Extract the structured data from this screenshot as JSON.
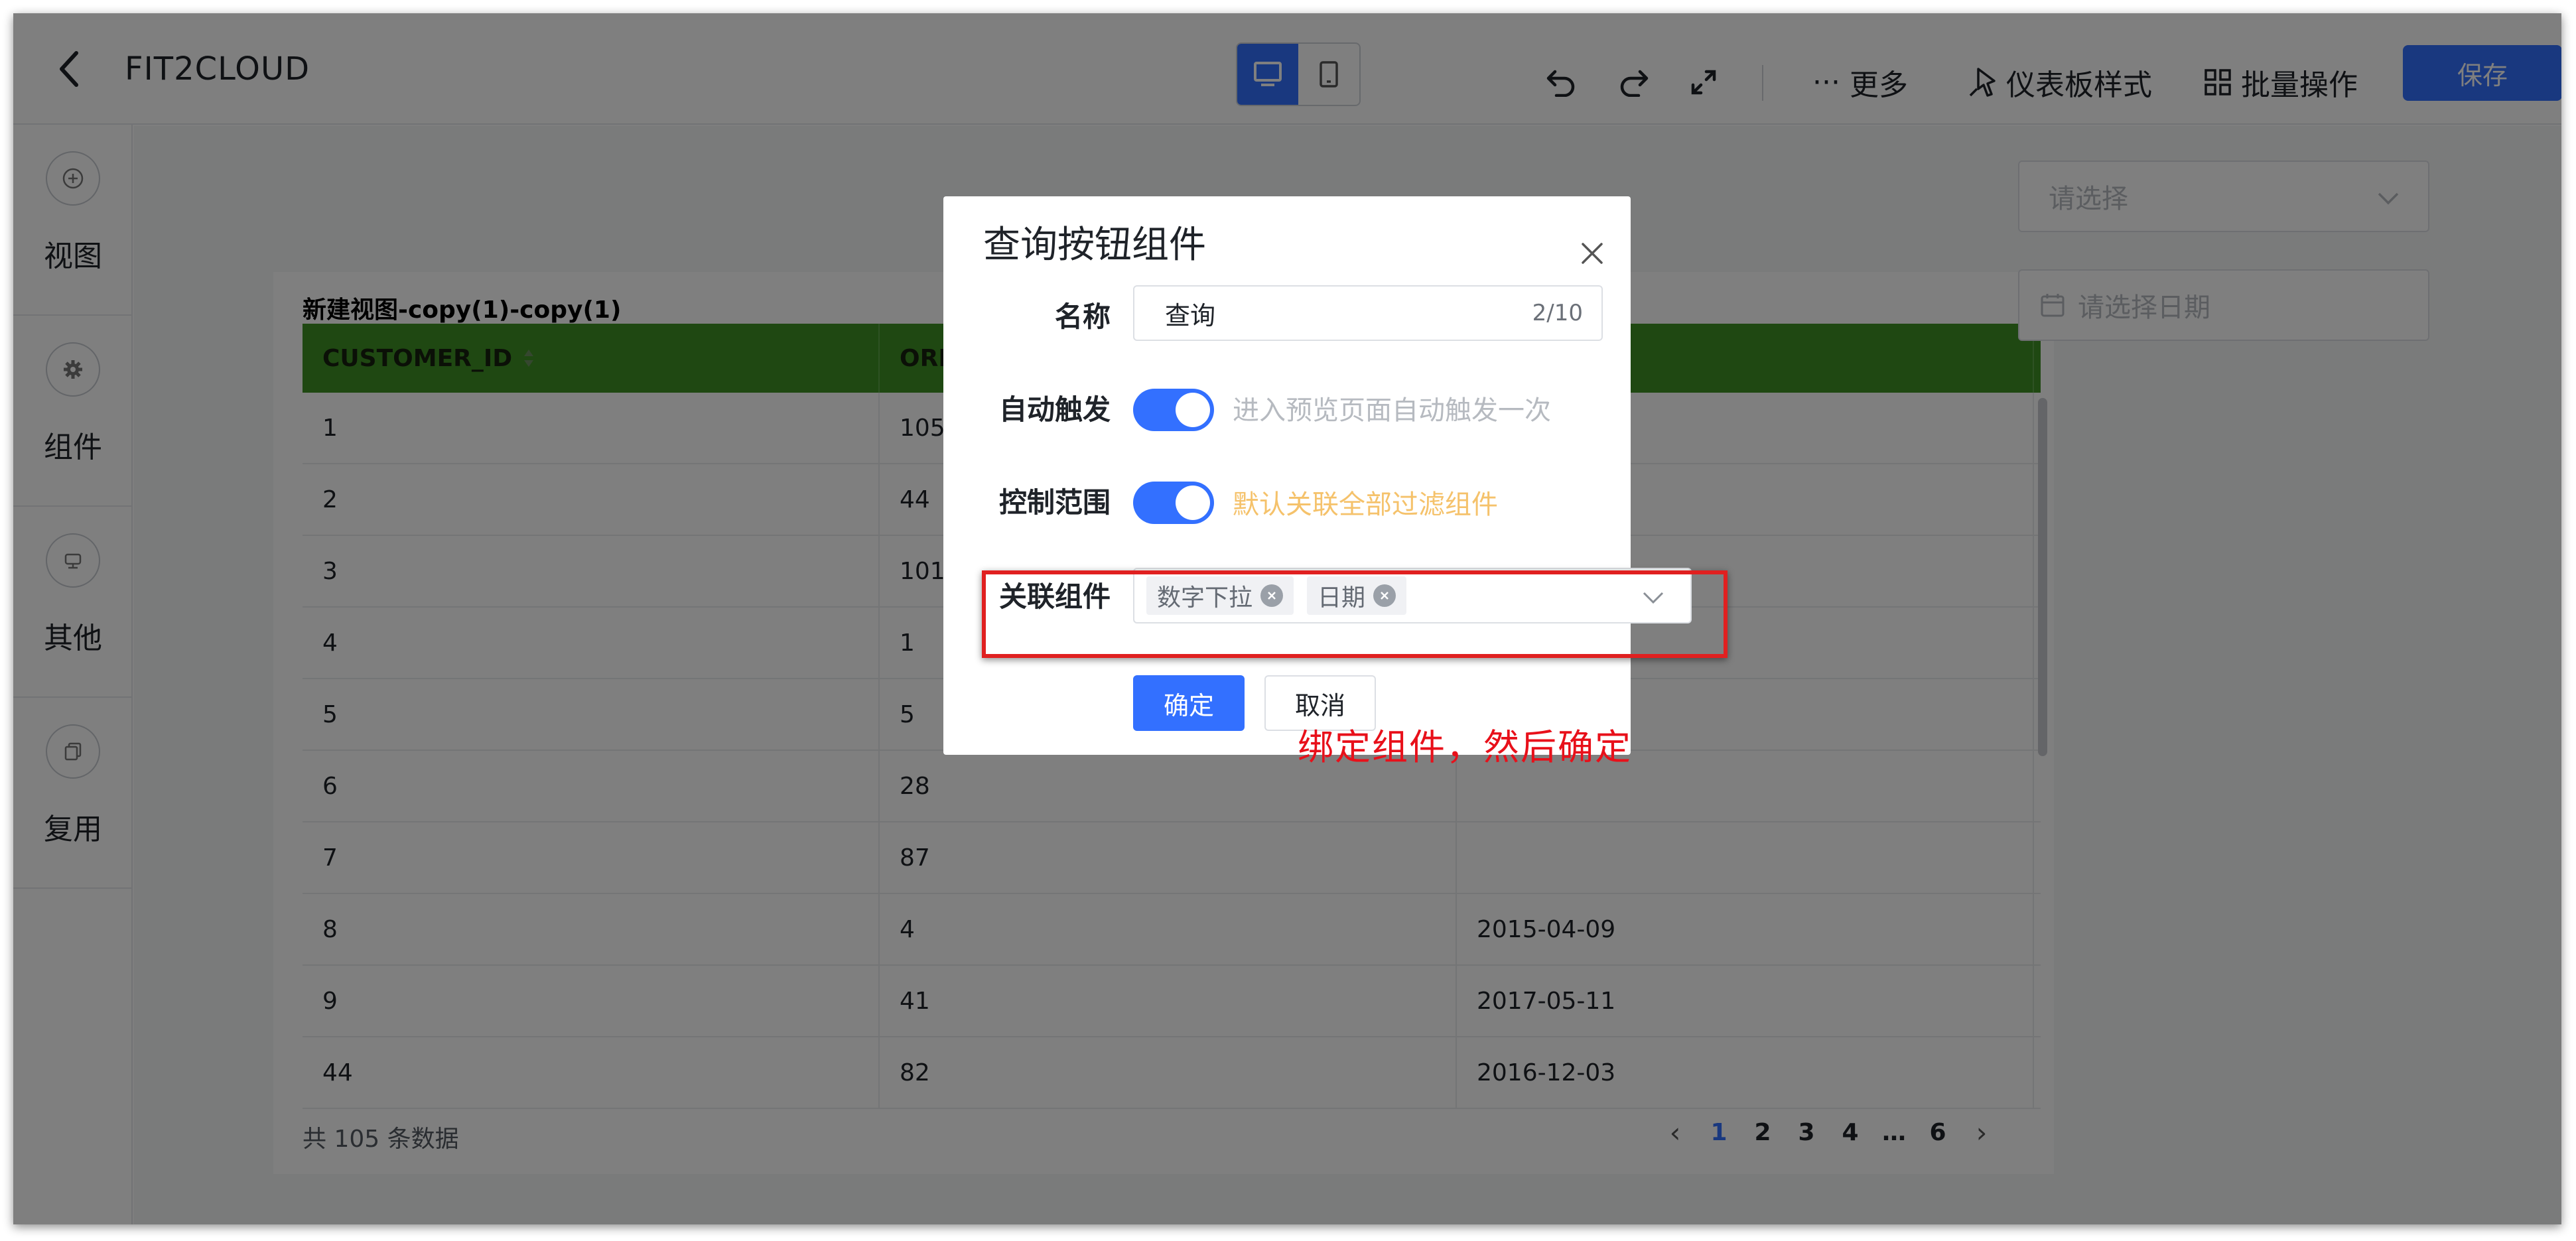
{
  "header": {
    "title": "FIT2CLOUD",
    "more_label": "更多",
    "dashboard_style_label": "仪表板样式",
    "batch_label": "批量操作",
    "save_label": "保存"
  },
  "sidebar": {
    "items": [
      {
        "label": "视图",
        "icon": "plus-circle-icon"
      },
      {
        "label": "组件",
        "icon": "gear-icon"
      },
      {
        "label": "其他",
        "icon": "stamp-icon"
      },
      {
        "label": "复用",
        "icon": "copy-icon"
      }
    ]
  },
  "table_widget": {
    "title": "新建视图-copy(1)-copy(1)",
    "columns": [
      "CUSTOMER_ID",
      "ORDER_ID",
      ""
    ],
    "rows": [
      [
        "1",
        "105",
        ""
      ],
      [
        "2",
        "44",
        ""
      ],
      [
        "3",
        "101",
        ""
      ],
      [
        "4",
        "1",
        ""
      ],
      [
        "5",
        "5",
        ""
      ],
      [
        "6",
        "28",
        ""
      ],
      [
        "7",
        "87",
        ""
      ],
      [
        "8",
        "4",
        "2015-04-09"
      ],
      [
        "9",
        "41",
        "2017-05-11"
      ],
      [
        "44",
        "82",
        "2016-12-03"
      ]
    ],
    "total_text": "共 105 条数据",
    "pages": [
      "1",
      "2",
      "3",
      "4",
      "…",
      "6"
    ],
    "current_page": "1"
  },
  "filters": {
    "select_placeholder": "请选择",
    "date_placeholder": "请选择日期"
  },
  "dialog": {
    "title": "查询按钮组件",
    "name_label": "名称",
    "name_value": "查询",
    "name_count": "2/10",
    "auto_label": "自动触发",
    "auto_hint": "进入预览页面自动触发一次",
    "auto_enabled": true,
    "range_label": "控制范围",
    "range_hint": "默认关联全部过滤组件",
    "range_enabled": true,
    "link_label": "关联组件",
    "link_tags": [
      "数字下拉",
      "日期"
    ],
    "ok_label": "确定",
    "cancel_label": "取消"
  },
  "annotation": {
    "text": "绑定组件，然后确定",
    "color": "#e8101a"
  },
  "colors": {
    "accent": "#3370ff",
    "table_header": "#3e9124",
    "hint_warning": "#f5c26b"
  }
}
